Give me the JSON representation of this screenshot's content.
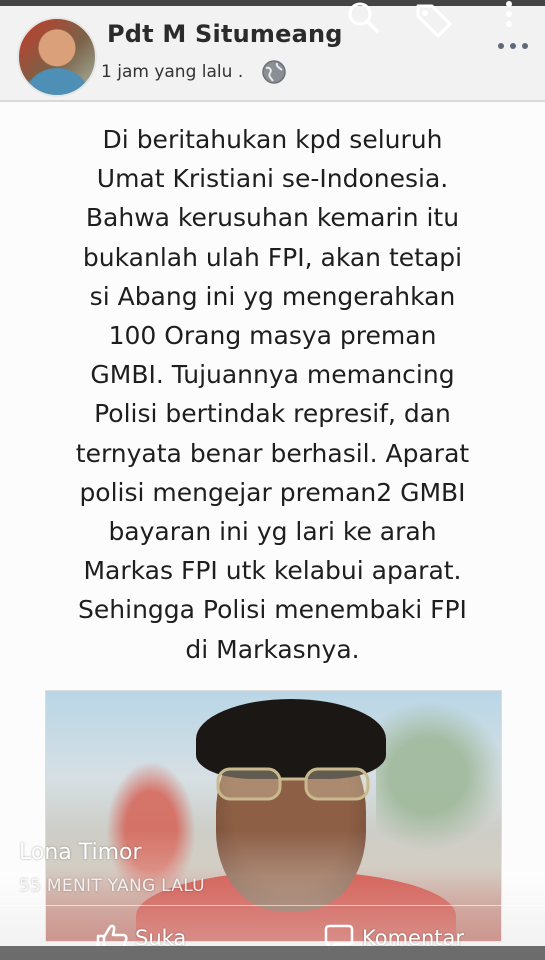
{
  "header": {
    "author_name": "Pdt M Situmeang",
    "timestamp": "1 jam yang lalu",
    "separator": ".",
    "privacy_icon": "globe-icon",
    "actions": [
      "search-icon",
      "tag-icon",
      "more-vertical-icon",
      "more-horizontal-icon"
    ]
  },
  "post": {
    "lines": [
      "Di beritahukan kpd seluruh",
      "Umat Kristiani se-Indonesia.",
      "Bahwa kerusuhan kemarin itu",
      "bukanlah ulah FPI, akan tetapi",
      "si Abang ini yg mengerahkan",
      "100 Orang masya preman",
      "GMBI. Tujuannya memancing",
      "Polisi bertindak represif, dan",
      "ternyata benar berhasil. Aparat",
      "polisi mengejar preman2 GMBI",
      "bayaran ini yg lari ke arah",
      "Markas FPI utk kelabui aparat.",
      "Sehingga Polisi menembaki FPI",
      "di Markasnya."
    ]
  },
  "comment_overlay": {
    "commenter_name": "Lona Timor",
    "comment_time": "55 MENIT YANG LALU",
    "like_label": "Suka",
    "comment_label": "Komentar"
  },
  "colors": {
    "header_bg": "#f2f2f2",
    "text": "#1e1e1e",
    "shirt_red": "#c8352a"
  }
}
